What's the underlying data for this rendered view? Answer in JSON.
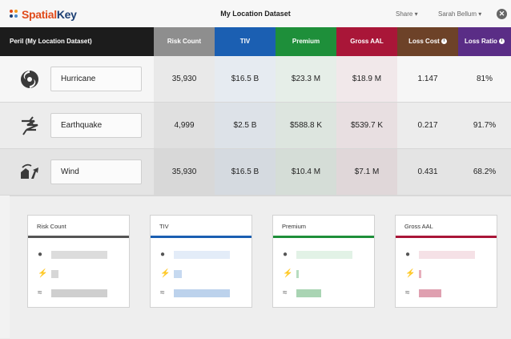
{
  "header": {
    "brand_a": "Spatial",
    "brand_b": "Key",
    "title": "My Location Dataset",
    "share": "Share ▾",
    "user": "Sarah Bellum ▾",
    "close_glyph": "✕"
  },
  "colors": {
    "risk": "#8e8e8e",
    "tiv": "#1b5fb2",
    "premium": "#1e8f3a",
    "aal": "#a91638",
    "loss_cost": "#6d4228",
    "loss_ratio": "#5a2d86"
  },
  "table": {
    "columns": {
      "peril": "Peril (My Location Dataset)",
      "risk": "Risk Count",
      "tiv": "TIV",
      "premium": "Premium",
      "aal": "Gross AAL",
      "loss_cost": "Loss Cost",
      "loss_ratio": "Loss Ratio"
    },
    "rows": [
      {
        "icon": "hurricane-icon",
        "peril": "Hurricane",
        "risk": "35,930",
        "tiv": "$16.5 B",
        "premium": "$23.3 M",
        "aal": "$18.9 M",
        "loss_cost": "1.147",
        "loss_ratio": "81%"
      },
      {
        "icon": "earthquake-icon",
        "peril": "Earthquake",
        "risk": "4,999",
        "tiv": "$2.5 B",
        "premium": "$588.8 K",
        "aal": "$539.7 K",
        "loss_cost": "0.217",
        "loss_ratio": "91.7%"
      },
      {
        "icon": "wind-icon",
        "peril": "Wind",
        "risk": "35,930",
        "tiv": "$16.5 B",
        "premium": "$10.4 M",
        "aal": "$7.1 M",
        "loss_cost": "0.431",
        "loss_ratio": "68.2%"
      }
    ]
  },
  "cards": [
    {
      "title": "Risk Count",
      "bar_fraction": [
        0.0,
        0.0,
        0.0
      ]
    },
    {
      "title": "TIV",
      "bar_fraction": [
        0.0,
        0.0,
        0.0
      ]
    },
    {
      "title": "Premium",
      "bar_fraction": [
        0.0,
        0.0,
        0.0
      ]
    },
    {
      "title": "Gross AAL",
      "bar_fraction": [
        0.0,
        0.0,
        0.0
      ]
    }
  ]
}
